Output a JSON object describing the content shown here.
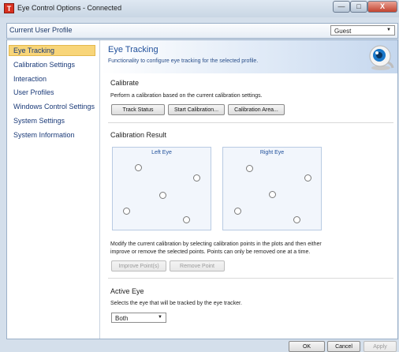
{
  "window": {
    "title": "Eye Control Options - Connected",
    "app_icon_letter": "T",
    "minimize": "—",
    "maximize": "□",
    "close": "X"
  },
  "profile": {
    "label": "Current User Profile",
    "selected": "Guest"
  },
  "sidebar": {
    "items": [
      {
        "label": "Eye Tracking",
        "active": true
      },
      {
        "label": "Calibration Settings"
      },
      {
        "label": "Interaction"
      },
      {
        "label": "User Profiles"
      },
      {
        "label": "Windows Control Settings"
      },
      {
        "label": "System Settings"
      },
      {
        "label": "System Information"
      }
    ]
  },
  "header": {
    "title": "Eye Tracking",
    "description": "Functionality to configure eye tracking for the selected profile.",
    "icon": "eye-camera-icon"
  },
  "calibrate": {
    "title": "Calibrate",
    "description": "Perform a calibration based on the current calibration settings.",
    "buttons": {
      "track_status": "Track Status",
      "start_calibration": "Start Calibration...",
      "calibration_area": "Calibration Area..."
    }
  },
  "calibration_result": {
    "title": "Calibration Result",
    "left_eye": "Left Eye",
    "right_eye": "Right Eye",
    "help_line1": "Modify the current calibration by selecting calibration points in the plots and then either",
    "help_line2": "improve or remove the selected points. Points can only be removed one at a time.",
    "improve_button": "Improve Point(s)",
    "remove_button": "Remove Point"
  },
  "active_eye": {
    "title": "Active Eye",
    "description": "Selects the eye that will be tracked by the eye tracker.",
    "selected": "Both"
  },
  "footer": {
    "ok": "OK",
    "cancel": "Cancel",
    "apply": "Apply"
  },
  "colors": {
    "accent_blue": "#1f4f9a",
    "nav_highlight": "#f8d579",
    "close_red": "#c2432f"
  }
}
